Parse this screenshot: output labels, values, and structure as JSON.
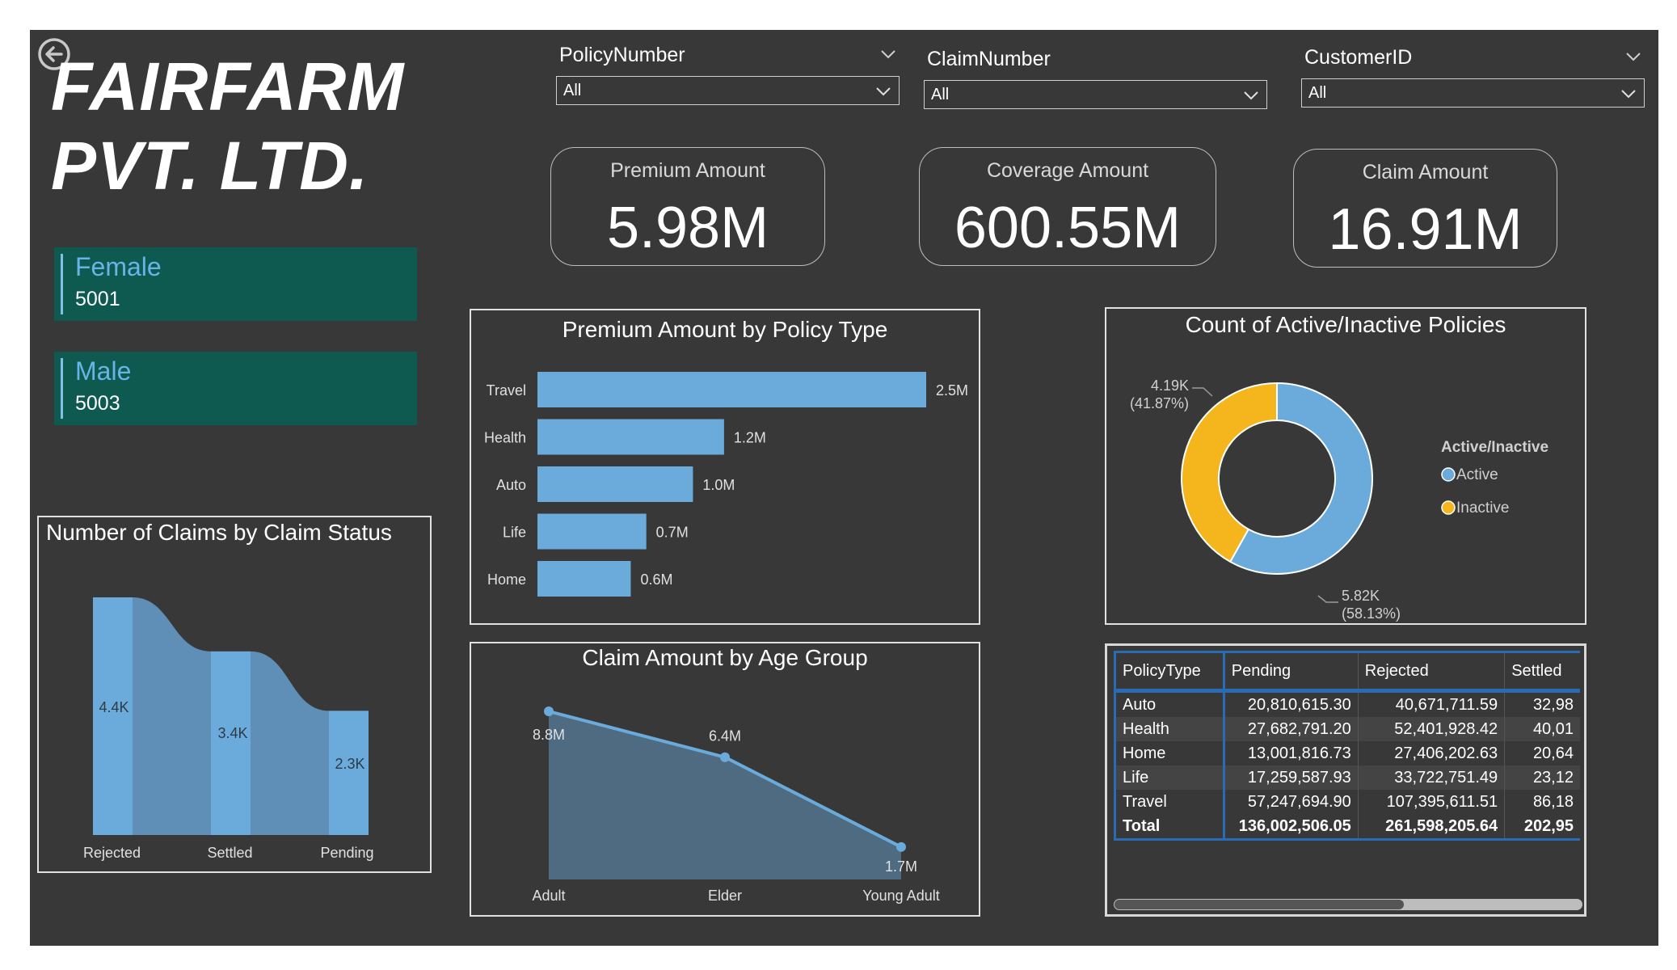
{
  "title": {
    "line1": "FAIRFARM",
    "line2": "PVT. LTD."
  },
  "gender": [
    {
      "label": "Female",
      "value": "5001"
    },
    {
      "label": "Male",
      "value": "5003"
    }
  ],
  "slicers": [
    {
      "title": "PolicyNumber",
      "value": "All"
    },
    {
      "title": "ClaimNumber",
      "value": "All"
    },
    {
      "title": "CustomerID",
      "value": "All"
    }
  ],
  "kpis": [
    {
      "title": "Premium Amount",
      "value": "5.98M"
    },
    {
      "title": "Coverage Amount",
      "value": "600.55M"
    },
    {
      "title": "Claim Amount",
      "value": "16.91M"
    }
  ],
  "colors": {
    "bar": "#6aabdc",
    "active": "#6aabdc",
    "inactive": "#f5b51c",
    "area": "#4f6b82",
    "card": "#0e5a50",
    "accent": "#2a6bb5"
  },
  "icons": {
    "back": "circle-arrow-left-icon",
    "slicer_chevron": "chevron-down-icon"
  },
  "chart_data": [
    {
      "type": "bar",
      "title": "Premium Amount by Policy Type",
      "orientation": "horizontal",
      "categories": [
        "Travel",
        "Health",
        "Auto",
        "Life",
        "Home"
      ],
      "values": [
        2.5,
        1.2,
        1.0,
        0.7,
        0.6
      ],
      "value_labels": [
        "2.5M",
        "1.2M",
        "1.0M",
        "0.7M",
        "0.6M"
      ],
      "unit": "M"
    },
    {
      "type": "bar",
      "subtype": "ribbon",
      "title": "Number of Claims by Claim Status",
      "categories": [
        "Rejected",
        "Settled",
        "Pending"
      ],
      "values": [
        4.4,
        3.4,
        2.3
      ],
      "value_labels": [
        "4.4K",
        "3.4K",
        "2.3K"
      ],
      "unit": "K"
    },
    {
      "type": "area",
      "title": "Claim Amount by Age Group",
      "categories": [
        "Adult",
        "Elder",
        "Young Adult"
      ],
      "values": [
        8.8,
        6.4,
        1.7
      ],
      "value_labels": [
        "8.8M",
        "6.4M",
        "1.7M"
      ],
      "unit": "M"
    },
    {
      "type": "pie",
      "subtype": "donut",
      "title": "Count of Active/Inactive Policies",
      "legend_title": "Active/Inactive",
      "legend_position": "right",
      "slices": [
        {
          "name": "Active",
          "value": 5.82,
          "label": "5.82K",
          "percent": "(58.13%)"
        },
        {
          "name": "Inactive",
          "value": 4.19,
          "label": "4.19K",
          "percent": "(41.87%)"
        }
      ]
    }
  ],
  "table": {
    "headers": [
      "PolicyType",
      "Pending",
      "Rejected",
      "Settled"
    ],
    "rows": [
      [
        "Auto",
        "20,810,615.30",
        "40,671,711.59",
        "32,98"
      ],
      [
        "Health",
        "27,682,791.20",
        "52,401,928.42",
        "40,01"
      ],
      [
        "Home",
        "13,001,816.73",
        "27,406,202.63",
        "20,64"
      ],
      [
        "Life",
        "17,259,587.93",
        "33,722,751.49",
        "23,12"
      ],
      [
        "Travel",
        "57,247,694.90",
        "107,395,611.51",
        "86,18"
      ]
    ],
    "total": [
      "Total",
      "136,002,506.05",
      "261,598,205.64",
      "202,95"
    ]
  }
}
